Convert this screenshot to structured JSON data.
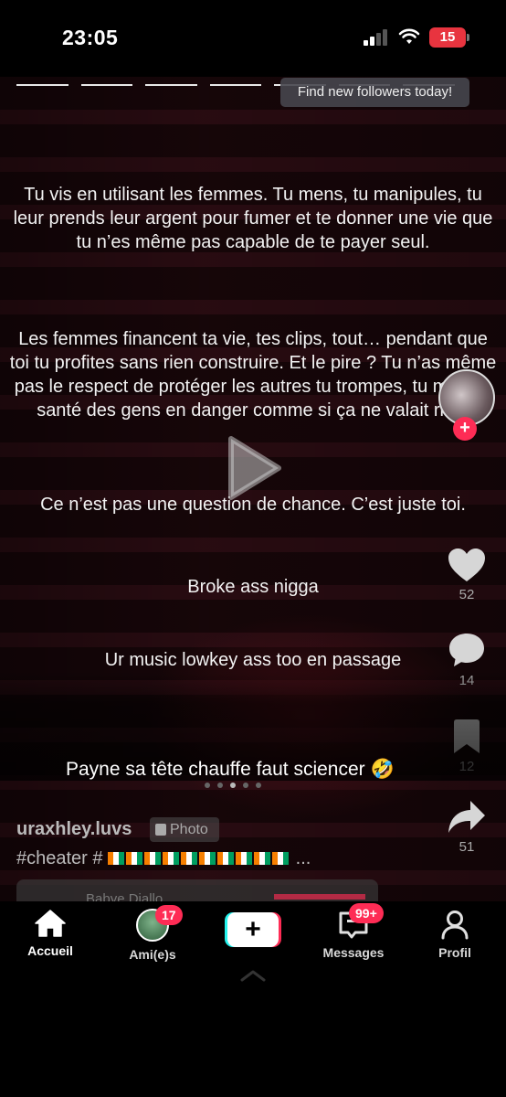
{
  "status_bar": {
    "time": "23:05",
    "battery": "15"
  },
  "video": {
    "follow_banner": "Find new followers today!",
    "captions": [
      "Tu vis en utilisant les femmes. Tu mens, tu manipules, tu leur prends leur argent pour fumer et te donner une vie que tu n’es même pas capable de te payer seul.",
      "Les femmes financent ta vie, tes clips, tout… pendant que toi tu profites sans rien construire. Et le pire ? Tu n’as même pas le respect de protéger les autres tu trompes, tu mets la santé des gens en danger comme si ça ne valait rien.",
      "Ce n’est pas une question de chance. C’est juste toi.",
      "Broke ass nigga",
      "Ur music lowkey ass too en passage"
    ]
  },
  "rail": {
    "avatar_plus": "+",
    "likes": "52",
    "comments": "14",
    "saves": "12",
    "shares": "51"
  },
  "comment_text": "Payne sa tête chauffe faut sciencer 🤣",
  "post": {
    "username": "uraxhley.luvs",
    "badge": "Photo",
    "hashtag": "#cheater #",
    "ellipsis": "...",
    "music_text": "Babye Diallo"
  },
  "tab_bar": {
    "home": "Accueil",
    "friends": "Ami(e)s",
    "friends_badge": "17",
    "create": "+",
    "messages": "Messages",
    "messages_badge": "99+",
    "profile": "Profil"
  }
}
